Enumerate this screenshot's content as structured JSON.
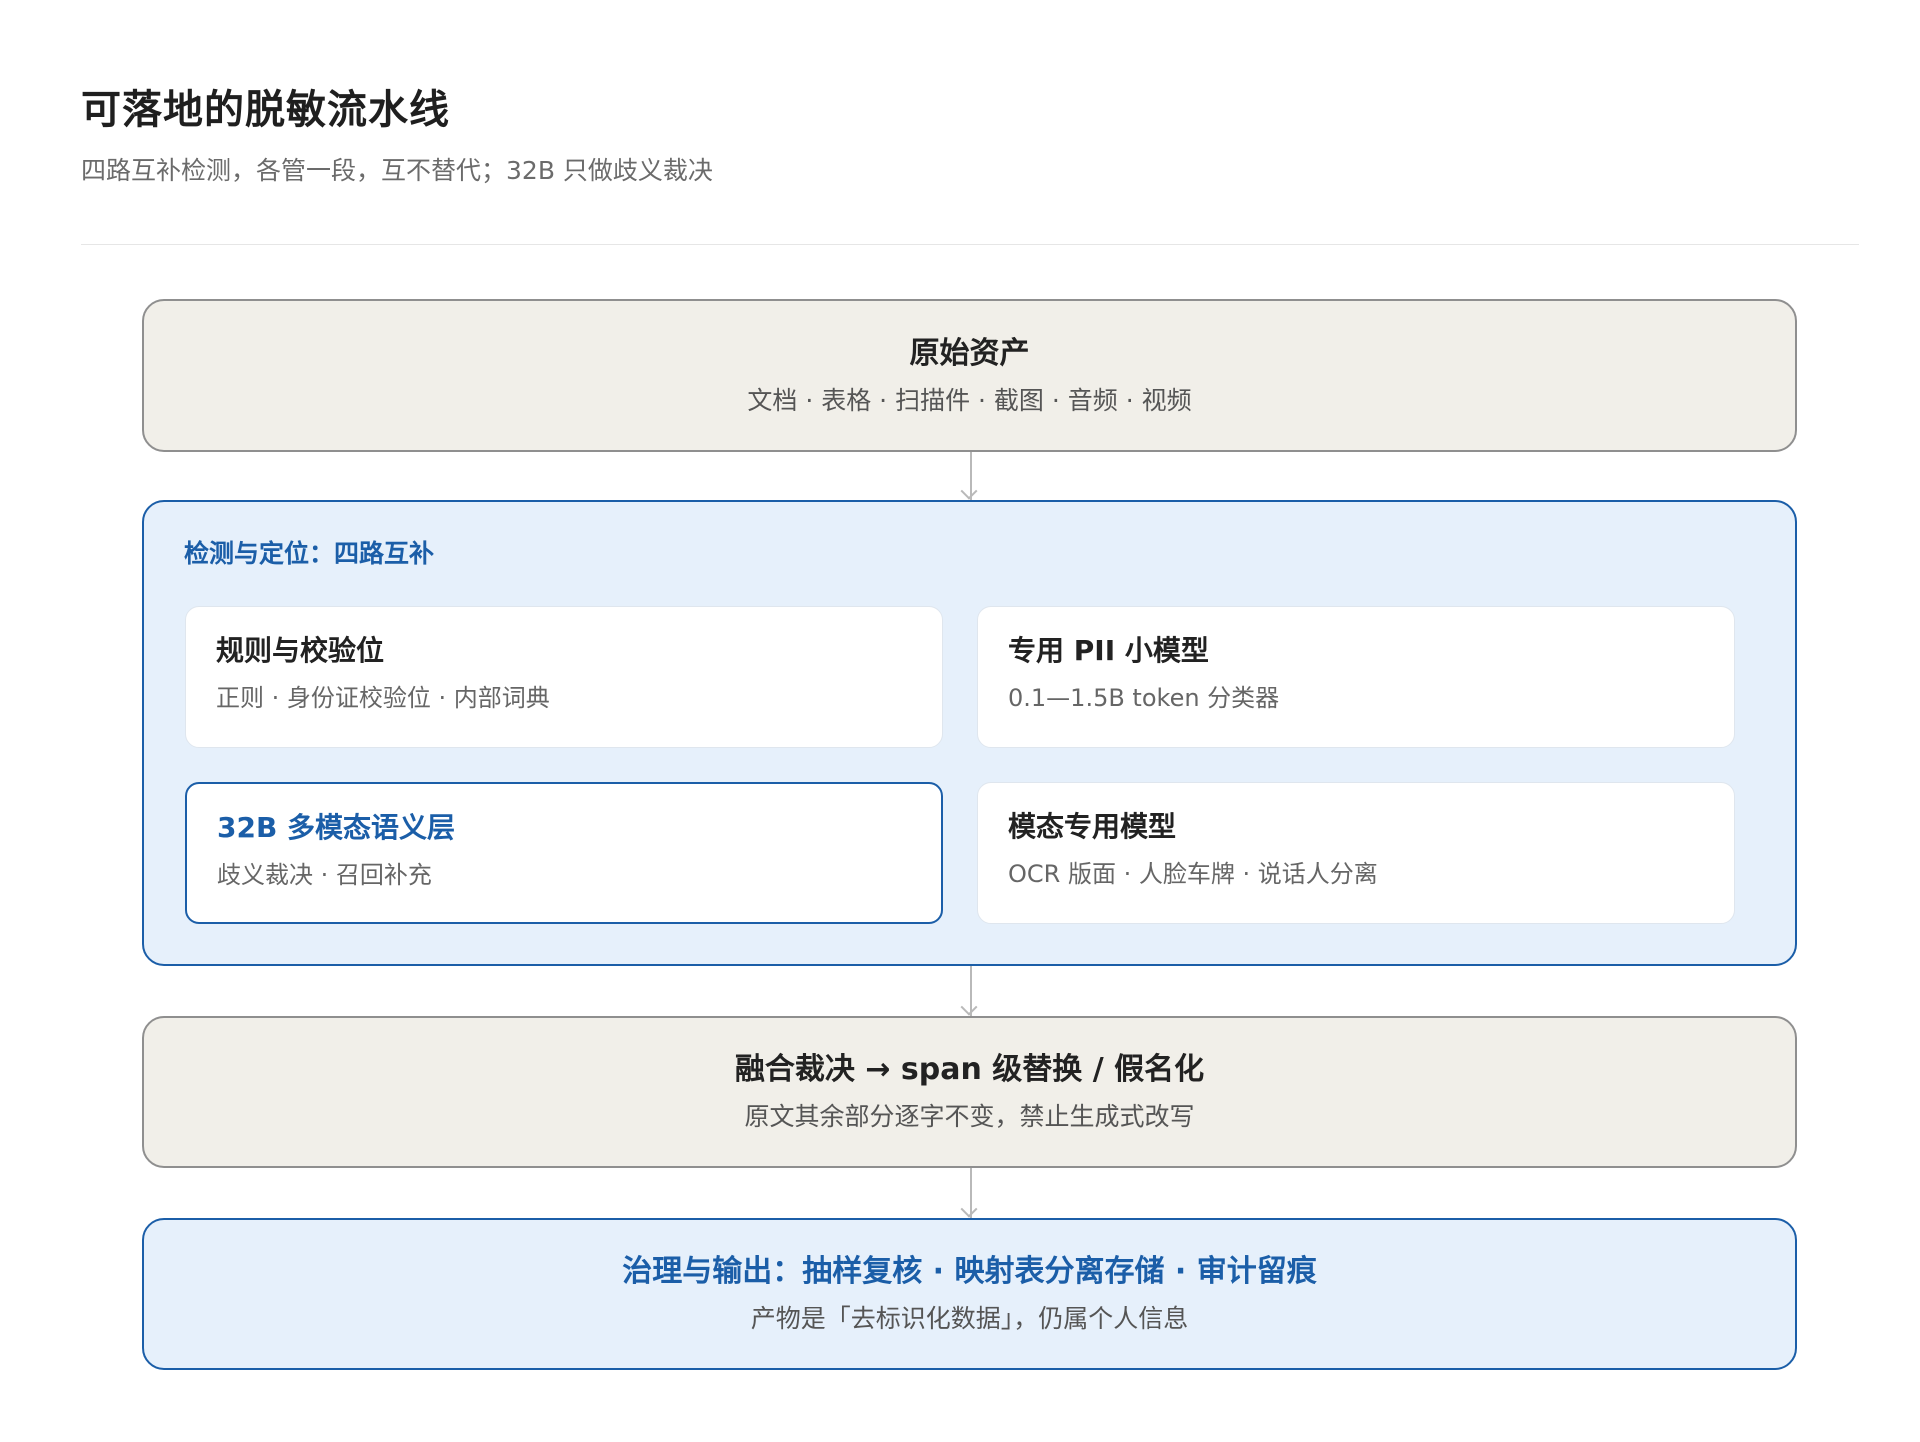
{
  "header": {
    "title": "可落地的脱敏流水线",
    "subtitle": "四路互补检测，各管一段，互不替代；32B 只做歧义裁决"
  },
  "source": {
    "title": "原始资产",
    "desc": "文档 · 表格 · 扫描件 · 截图 · 音频 · 视频"
  },
  "detection": {
    "label": "检测与定位：四路互补",
    "cards": [
      {
        "title": "规则与校验位",
        "desc": "正则 · 身份证校验位 · 内部词典"
      },
      {
        "title": "专用 PII 小模型",
        "desc": "0.1—1.5B token 分类器"
      },
      {
        "title": "32B 多模态语义层",
        "desc": "歧义裁决 · 召回补充"
      },
      {
        "title": "模态专用模型",
        "desc": "OCR 版面 · 人脸车牌 · 说话人分离"
      }
    ]
  },
  "fusion": {
    "title": "融合裁决 → span 级替换 / 假名化",
    "desc": "原文其余部分逐字不变，禁止生成式改写"
  },
  "governance": {
    "title": "治理与输出：抽样复核 · 映射表分离存储 · 审计留痕",
    "desc": "产物是「去标识化数据」，仍属个人信息"
  },
  "colors": {
    "accent_blue": "#1b5ea8",
    "beige_fill": "#f1efe9",
    "blue_fill": "#e6f0fb"
  }
}
